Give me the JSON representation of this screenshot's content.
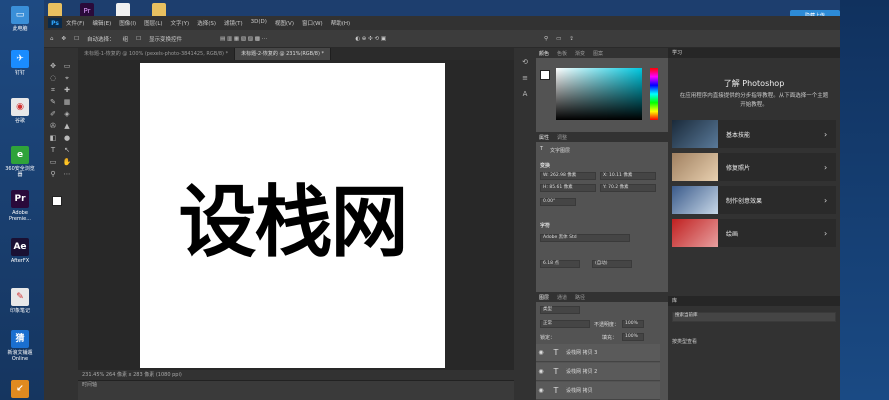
{
  "desktop": {
    "icons": [
      {
        "label": "此电脑",
        "name": "this-pc",
        "color": "#3a8fd8",
        "glyph": "▭"
      },
      {
        "label": "钉钉",
        "name": "dingtalk",
        "color": "#1a8cff",
        "glyph": "✈"
      },
      {
        "label": "谷歌",
        "name": "chrome",
        "color": "#e8e8e8",
        "glyph": "◉"
      },
      {
        "label": "360安全浏览器",
        "name": "360-browser",
        "color": "#2fa33a",
        "glyph": "e"
      },
      {
        "label": "Adobe Premie...",
        "name": "premiere",
        "color": "#2a0a3a",
        "glyph": "Pr"
      },
      {
        "label": "AfterFX",
        "name": "after-effects",
        "color": "#1a1033",
        "glyph": "Ae"
      },
      {
        "label": "印象笔记",
        "name": "evernote",
        "color": "#e8e8e8",
        "glyph": "✎"
      },
      {
        "label": "新浪文铺遁 Online",
        "name": "online-app",
        "color": "#1a6fd0",
        "glyph": "猜"
      },
      {
        "label": "",
        "name": "arrow",
        "color": "#e08a20",
        "glyph": "↙"
      }
    ],
    "topright_label": "隐藏上传"
  },
  "ps": {
    "logo": "Ps",
    "menu": [
      "文件(F)",
      "编辑(E)",
      "图像(I)",
      "图层(L)",
      "文字(Y)",
      "选择(S)",
      "滤镜(T)",
      "3D(D)",
      "视图(V)",
      "窗口(W)",
      "帮助(H)"
    ],
    "options": {
      "auto_select": "自动选择：",
      "group": "组",
      "show_transform": "显示变换控件"
    },
    "tabs": [
      {
        "label": "未标题-1-恢复的 @ 100% (pexels-photo-3841425, RGB/8) *",
        "active": false
      },
      {
        "label": "未标题-2-恢复的 @ 231%(RGB/8) *",
        "active": true
      }
    ],
    "canvas_text": "设栈网",
    "status": "231.45%  264 像素 x 283 像素 (1080 ppi)",
    "timeline_label": "时间轴"
  },
  "color_panel": {
    "tabs": [
      "颜色",
      "色板",
      "渐变",
      "图案"
    ]
  },
  "properties": {
    "tabs": [
      "属性",
      "调整"
    ],
    "layer_type": "文字图层",
    "transform_title": "变换",
    "w": "W: 262.98 像素",
    "x": "X: 10.11 像素",
    "h": "H: 85.61 像素",
    "y": "Y: 70.2 像素",
    "angle": "0.00°",
    "char_title": "字符",
    "font": "Adobe 黑体 Std",
    "size": "6.18 点",
    "leading": "(自动)"
  },
  "layers": {
    "tabs": [
      "图层",
      "通道",
      "路径"
    ],
    "kind": "类型",
    "blend": "正常",
    "opacity_label": "不透明度：",
    "opacity": "100%",
    "lock_label": "锁定：",
    "fill_label": "填充：",
    "fill": "100%",
    "items": [
      "设栈网 拷贝 3",
      "设栈网 拷贝 2",
      "设栈网 拷贝"
    ]
  },
  "learn": {
    "panel_title": "学习",
    "title": "了解 Photoshop",
    "desc": "在应用程序内直接提供的分步指导教程。从下面选择一个主题开始教程。",
    "cards": [
      {
        "label": "基本技能",
        "c1": "#1a2a3a",
        "c2": "#5a7a9a"
      },
      {
        "label": "修复照片",
        "c1": "#a08060",
        "c2": "#e8d0b0"
      },
      {
        "label": "制作创意效果",
        "c1": "#3a5a8a",
        "c2": "#c8d8e8"
      },
      {
        "label": "绘画",
        "c1": "#c02020",
        "c2": "#e8a0a0"
      }
    ],
    "lib_title": "库",
    "lib_search": "搜索当前库",
    "lib_view": "按类型查看"
  }
}
